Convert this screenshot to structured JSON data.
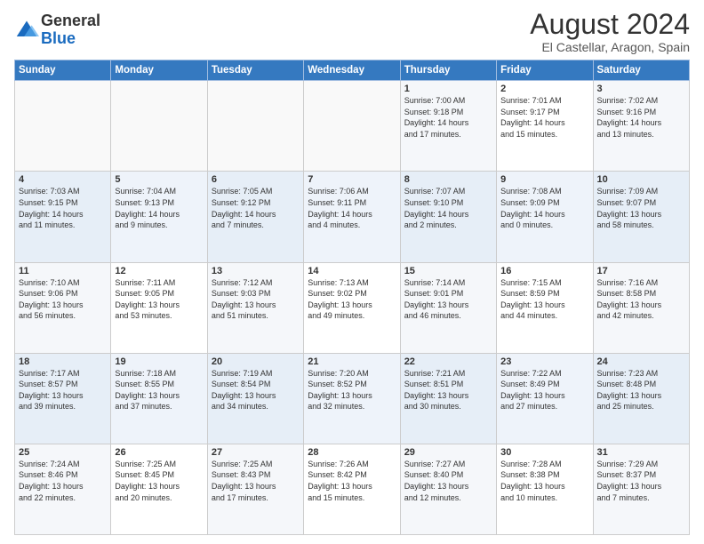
{
  "header": {
    "logo_general": "General",
    "logo_blue": "Blue",
    "month_title": "August 2024",
    "location": "El Castellar, Aragon, Spain"
  },
  "weekdays": [
    "Sunday",
    "Monday",
    "Tuesday",
    "Wednesday",
    "Thursday",
    "Friday",
    "Saturday"
  ],
  "weeks": [
    [
      {
        "day": "",
        "info": ""
      },
      {
        "day": "",
        "info": ""
      },
      {
        "day": "",
        "info": ""
      },
      {
        "day": "",
        "info": ""
      },
      {
        "day": "1",
        "info": "Sunrise: 7:00 AM\nSunset: 9:18 PM\nDaylight: 14 hours\nand 17 minutes."
      },
      {
        "day": "2",
        "info": "Sunrise: 7:01 AM\nSunset: 9:17 PM\nDaylight: 14 hours\nand 15 minutes."
      },
      {
        "day": "3",
        "info": "Sunrise: 7:02 AM\nSunset: 9:16 PM\nDaylight: 14 hours\nand 13 minutes."
      }
    ],
    [
      {
        "day": "4",
        "info": "Sunrise: 7:03 AM\nSunset: 9:15 PM\nDaylight: 14 hours\nand 11 minutes."
      },
      {
        "day": "5",
        "info": "Sunrise: 7:04 AM\nSunset: 9:13 PM\nDaylight: 14 hours\nand 9 minutes."
      },
      {
        "day": "6",
        "info": "Sunrise: 7:05 AM\nSunset: 9:12 PM\nDaylight: 14 hours\nand 7 minutes."
      },
      {
        "day": "7",
        "info": "Sunrise: 7:06 AM\nSunset: 9:11 PM\nDaylight: 14 hours\nand 4 minutes."
      },
      {
        "day": "8",
        "info": "Sunrise: 7:07 AM\nSunset: 9:10 PM\nDaylight: 14 hours\nand 2 minutes."
      },
      {
        "day": "9",
        "info": "Sunrise: 7:08 AM\nSunset: 9:09 PM\nDaylight: 14 hours\nand 0 minutes."
      },
      {
        "day": "10",
        "info": "Sunrise: 7:09 AM\nSunset: 9:07 PM\nDaylight: 13 hours\nand 58 minutes."
      }
    ],
    [
      {
        "day": "11",
        "info": "Sunrise: 7:10 AM\nSunset: 9:06 PM\nDaylight: 13 hours\nand 56 minutes."
      },
      {
        "day": "12",
        "info": "Sunrise: 7:11 AM\nSunset: 9:05 PM\nDaylight: 13 hours\nand 53 minutes."
      },
      {
        "day": "13",
        "info": "Sunrise: 7:12 AM\nSunset: 9:03 PM\nDaylight: 13 hours\nand 51 minutes."
      },
      {
        "day": "14",
        "info": "Sunrise: 7:13 AM\nSunset: 9:02 PM\nDaylight: 13 hours\nand 49 minutes."
      },
      {
        "day": "15",
        "info": "Sunrise: 7:14 AM\nSunset: 9:01 PM\nDaylight: 13 hours\nand 46 minutes."
      },
      {
        "day": "16",
        "info": "Sunrise: 7:15 AM\nSunset: 8:59 PM\nDaylight: 13 hours\nand 44 minutes."
      },
      {
        "day": "17",
        "info": "Sunrise: 7:16 AM\nSunset: 8:58 PM\nDaylight: 13 hours\nand 42 minutes."
      }
    ],
    [
      {
        "day": "18",
        "info": "Sunrise: 7:17 AM\nSunset: 8:57 PM\nDaylight: 13 hours\nand 39 minutes."
      },
      {
        "day": "19",
        "info": "Sunrise: 7:18 AM\nSunset: 8:55 PM\nDaylight: 13 hours\nand 37 minutes."
      },
      {
        "day": "20",
        "info": "Sunrise: 7:19 AM\nSunset: 8:54 PM\nDaylight: 13 hours\nand 34 minutes."
      },
      {
        "day": "21",
        "info": "Sunrise: 7:20 AM\nSunset: 8:52 PM\nDaylight: 13 hours\nand 32 minutes."
      },
      {
        "day": "22",
        "info": "Sunrise: 7:21 AM\nSunset: 8:51 PM\nDaylight: 13 hours\nand 30 minutes."
      },
      {
        "day": "23",
        "info": "Sunrise: 7:22 AM\nSunset: 8:49 PM\nDaylight: 13 hours\nand 27 minutes."
      },
      {
        "day": "24",
        "info": "Sunrise: 7:23 AM\nSunset: 8:48 PM\nDaylight: 13 hours\nand 25 minutes."
      }
    ],
    [
      {
        "day": "25",
        "info": "Sunrise: 7:24 AM\nSunset: 8:46 PM\nDaylight: 13 hours\nand 22 minutes."
      },
      {
        "day": "26",
        "info": "Sunrise: 7:25 AM\nSunset: 8:45 PM\nDaylight: 13 hours\nand 20 minutes."
      },
      {
        "day": "27",
        "info": "Sunrise: 7:25 AM\nSunset: 8:43 PM\nDaylight: 13 hours\nand 17 minutes."
      },
      {
        "day": "28",
        "info": "Sunrise: 7:26 AM\nSunset: 8:42 PM\nDaylight: 13 hours\nand 15 minutes."
      },
      {
        "day": "29",
        "info": "Sunrise: 7:27 AM\nSunset: 8:40 PM\nDaylight: 13 hours\nand 12 minutes."
      },
      {
        "day": "30",
        "info": "Sunrise: 7:28 AM\nSunset: 8:38 PM\nDaylight: 13 hours\nand 10 minutes."
      },
      {
        "day": "31",
        "info": "Sunrise: 7:29 AM\nSunset: 8:37 PM\nDaylight: 13 hours\nand 7 minutes."
      }
    ]
  ]
}
